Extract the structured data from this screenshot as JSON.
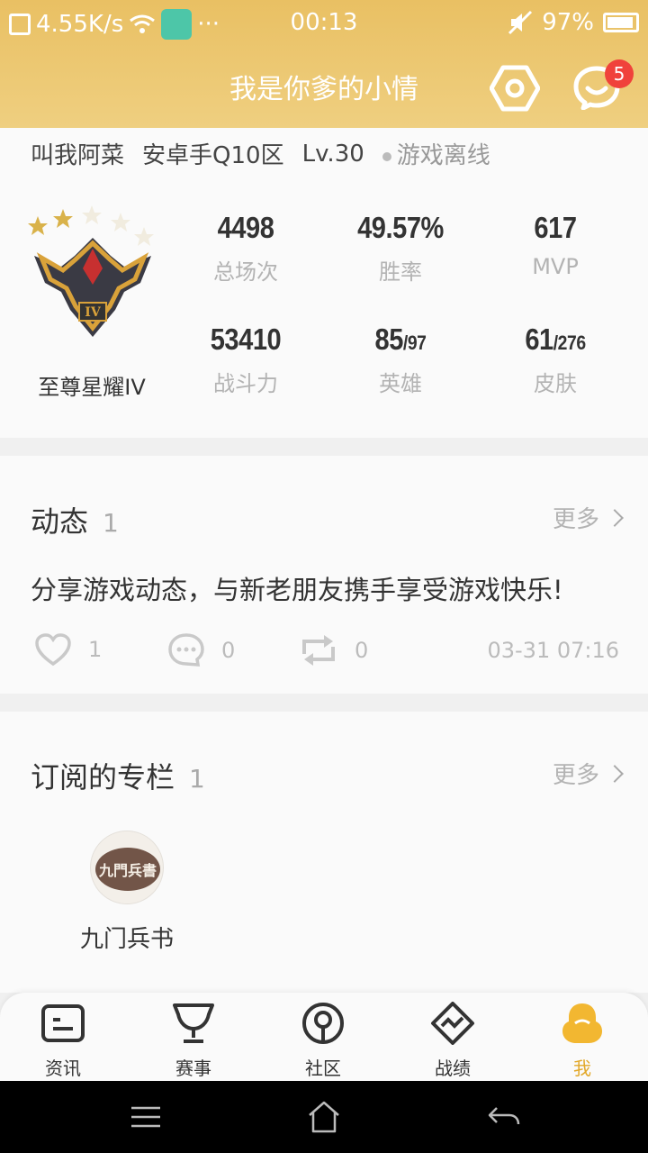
{
  "status_bar": {
    "net_speed": "4.55K/s",
    "more": "···",
    "time": "00:13",
    "battery": "97%"
  },
  "header": {
    "title": "我是你爹的小情",
    "message_badge": "5"
  },
  "profile": {
    "nickname": "叫我阿菜",
    "server": "安卓手Q10区",
    "level": "Lv.30",
    "status": "游戏离线",
    "rank_name": "至尊星耀IV",
    "rank_tier": "IV",
    "stats": [
      {
        "value": "4498",
        "label": "总场次"
      },
      {
        "value": "49.57%",
        "label": "胜率"
      },
      {
        "value": "617",
        "label": "MVP"
      },
      {
        "value": "53410",
        "label": "战斗力"
      },
      {
        "value": "85",
        "total": "/97",
        "label": "英雄"
      },
      {
        "value": "61",
        "total": "/276",
        "label": "皮肤"
      }
    ]
  },
  "dynamics": {
    "title": "动态",
    "count": "1",
    "more": "更多",
    "post_text": "分享游戏动态，与新老朋友携手享受游戏快乐!",
    "likes": "1",
    "comments": "0",
    "shares": "0",
    "timestamp": "03-31 07:16"
  },
  "columns": {
    "title": "订阅的专栏",
    "count": "1",
    "more": "更多",
    "items": [
      {
        "name": "九门兵书",
        "logo_text": "九門兵書"
      }
    ]
  },
  "tabbar": {
    "tabs": [
      {
        "label": "资讯",
        "icon": "news-icon"
      },
      {
        "label": "赛事",
        "icon": "trophy-icon"
      },
      {
        "label": "社区",
        "icon": "community-icon"
      },
      {
        "label": "战绩",
        "icon": "record-icon"
      },
      {
        "label": "我",
        "icon": "me-icon"
      }
    ],
    "accent": "#e2a829"
  },
  "colors": {
    "header": "#e9c063",
    "badge": "#f0423b"
  }
}
